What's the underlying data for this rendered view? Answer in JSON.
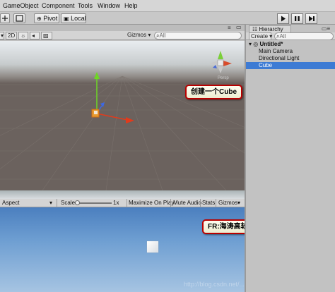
{
  "menu": [
    "GameObject",
    "Component",
    "Tools",
    "Window",
    "Help"
  ],
  "toolbar": {
    "pivot_label": "Pivot",
    "local_label": "Local"
  },
  "scene": {
    "mode_2d": "2D",
    "gizmos": "Gizmos",
    "search_placeholder": "All",
    "persp_label": "Persp"
  },
  "callout_scene": "创建一个Cube",
  "callout_game": "FR:海涛高软（hunk Xu)",
  "game": {
    "aspect": "Aspect",
    "scale_label": "Scale",
    "scale_value": "1x",
    "maximize": "Maximize On Play",
    "mute": "Mute Audio",
    "stats": "Stats",
    "gizmos": "Gizmos"
  },
  "hierarchy": {
    "tab": "Hierarchy",
    "create": "Create",
    "search_placeholder": "All",
    "scene_name": "Untitled*",
    "items": [
      "Main Camera",
      "Directional Light",
      "Cube"
    ],
    "selected_index": 2
  },
  "watermark": "http://blog.csdn.net/..."
}
